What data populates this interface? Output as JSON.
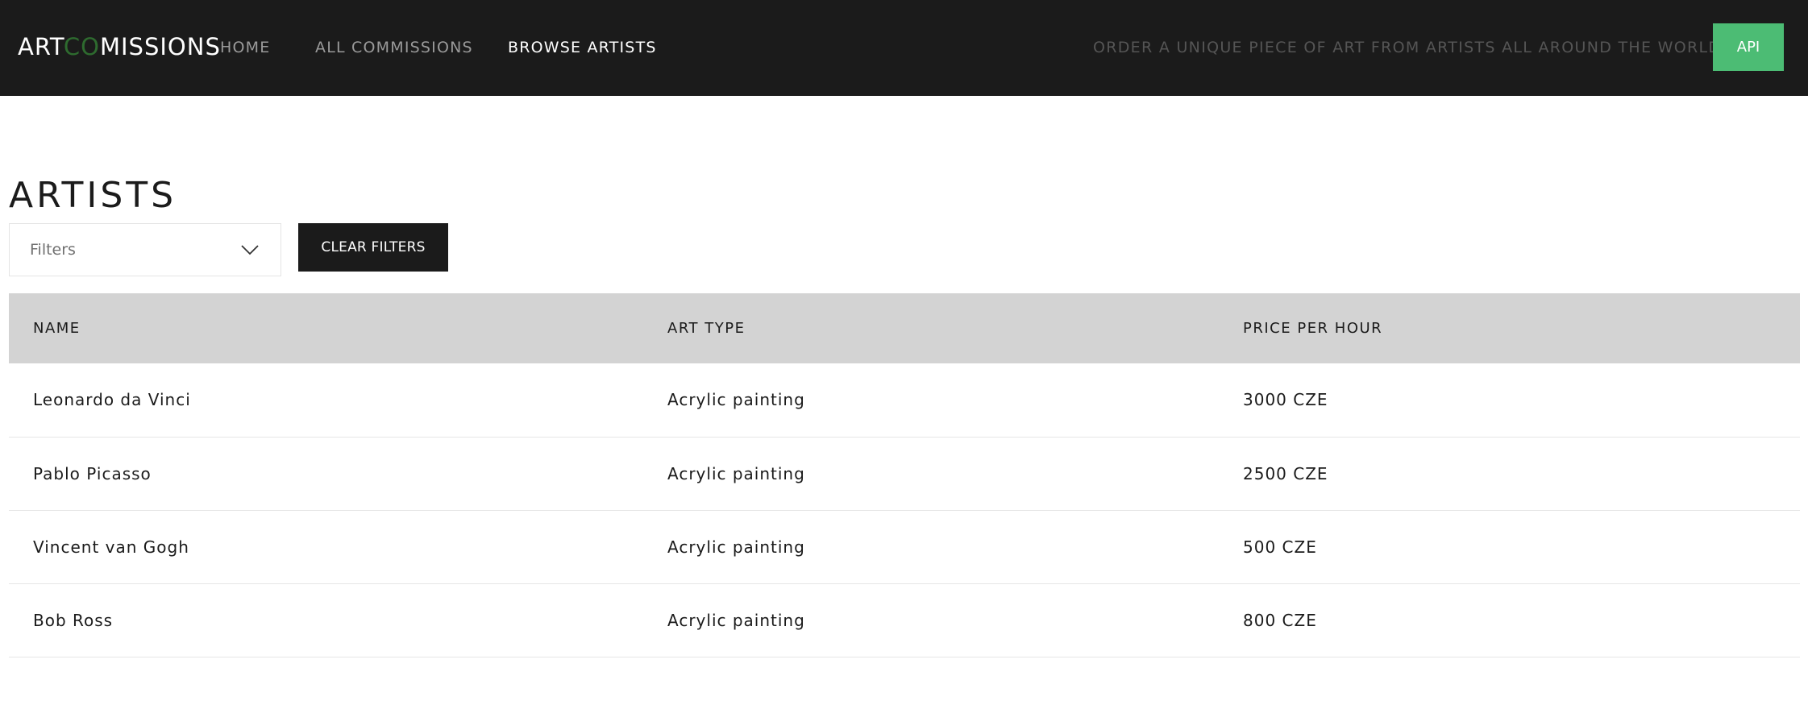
{
  "nav": {
    "brand_prefix": "ART",
    "brand_highlight": "CO",
    "brand_suffix": "MISSIONS",
    "links": [
      {
        "label": "HOME"
      },
      {
        "label": "ALL COMMISSIONS"
      },
      {
        "label": "BROWSE ARTISTS"
      }
    ],
    "tagline": "ORDER A UNIQUE PIECE OF ART FROM ARTISTS ALL AROUND THE WORLD",
    "api_label": "API"
  },
  "page": {
    "title": "ARTISTS",
    "filter_placeholder": "Filters",
    "clear_filters_label": "CLEAR FILTERS"
  },
  "table": {
    "headers": [
      "NAME",
      "ART TYPE",
      "PRICE PER HOUR"
    ],
    "rows": [
      {
        "name": "Leonardo da Vinci",
        "art_type": "Acrylic painting",
        "price": "3000 CZE"
      },
      {
        "name": "Pablo Picasso",
        "art_type": "Acrylic painting",
        "price": "2500 CZE"
      },
      {
        "name": "Vincent van Gogh",
        "art_type": "Acrylic painting",
        "price": "500 CZE"
      },
      {
        "name": "Bob Ross",
        "art_type": "Acrylic painting",
        "price": "800 CZE"
      }
    ]
  },
  "colors": {
    "navbar_bg": "#1b1b1b",
    "brand_accent": "#2e6b2f",
    "api_button": "#4cbc74",
    "table_header_bg": "#d3d3d3"
  },
  "icons": {
    "filter_dropdown": "chevron-down-icon"
  }
}
